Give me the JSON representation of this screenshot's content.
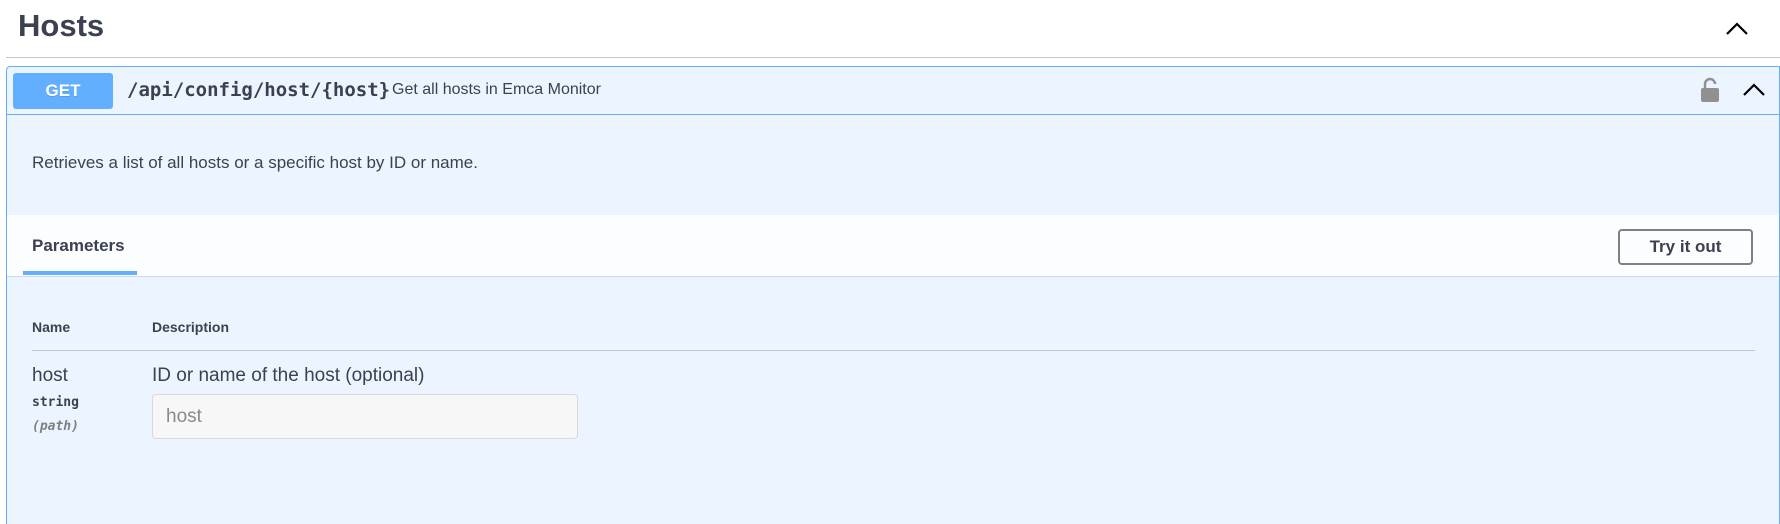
{
  "tag": {
    "title": "Hosts",
    "toggle_icon": "chevron-up-icon"
  },
  "operation": {
    "method": "GET",
    "path": "/api/config/host/{host}",
    "summary": "Get all hosts in Emca Monitor",
    "description": "Retrieves a list of all hosts or a specific host by ID or name.",
    "method_color": "#61affe",
    "icons": [
      "lock-icon",
      "chevron-up-icon"
    ]
  },
  "parameters_section": {
    "tab_label": "Parameters",
    "try_it_out_label": "Try it out",
    "columns": {
      "name": "Name",
      "description": "Description"
    },
    "params": [
      {
        "name": "host",
        "type": "string",
        "in": "(path)",
        "description": "ID or name of the host (optional)",
        "placeholder": "host",
        "value": ""
      }
    ]
  }
}
